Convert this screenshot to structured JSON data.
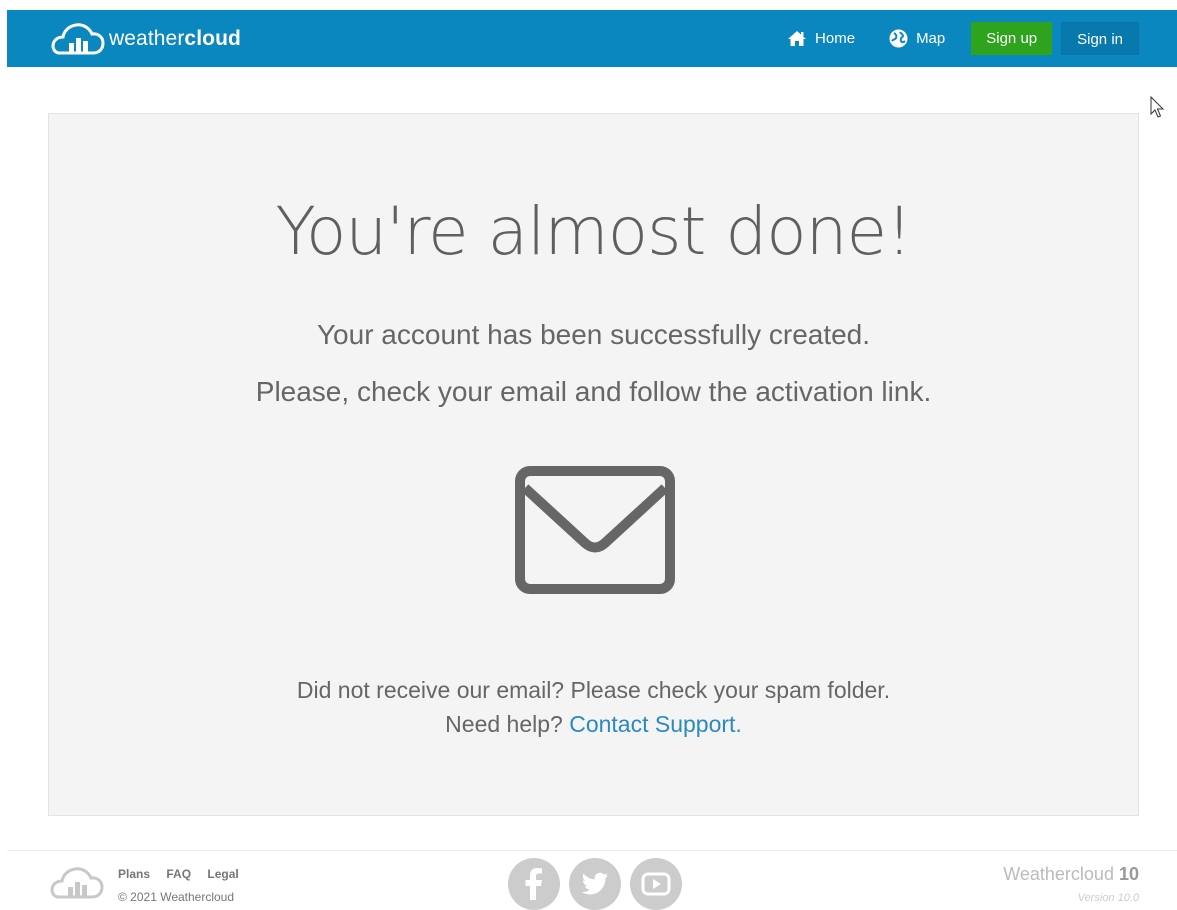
{
  "header": {
    "logo_light": "weather",
    "logo_bold": "cloud",
    "nav": [
      {
        "label": "Home",
        "icon": "home-icon"
      },
      {
        "label": "Map",
        "icon": "globe-icon"
      }
    ],
    "signup_label": "Sign up",
    "signin_label": "Sign in"
  },
  "main": {
    "title": "You're almost done!",
    "message_1": "Your account has been successfully created.",
    "message_2": "Please, check your email and follow the activation link.",
    "icon": "envelope-icon",
    "help_line_1": "Did not receive our email? Please check your spam folder.",
    "help_prefix": "Need help? ",
    "help_link": "Contact Support."
  },
  "footer": {
    "links": [
      "Plans",
      "FAQ",
      "Legal"
    ],
    "copyright": "© 2021 Weathercloud",
    "social": [
      "facebook-icon",
      "twitter-icon",
      "youtube-icon"
    ],
    "brand_name": "Weathercloud",
    "brand_number": "10",
    "version": "Version 10.0"
  },
  "colors": {
    "header_bg": "#0a87bf",
    "signup_bg": "#2ea31e",
    "link": "#2a8ac0",
    "panel_bg": "#f4f4f4"
  }
}
